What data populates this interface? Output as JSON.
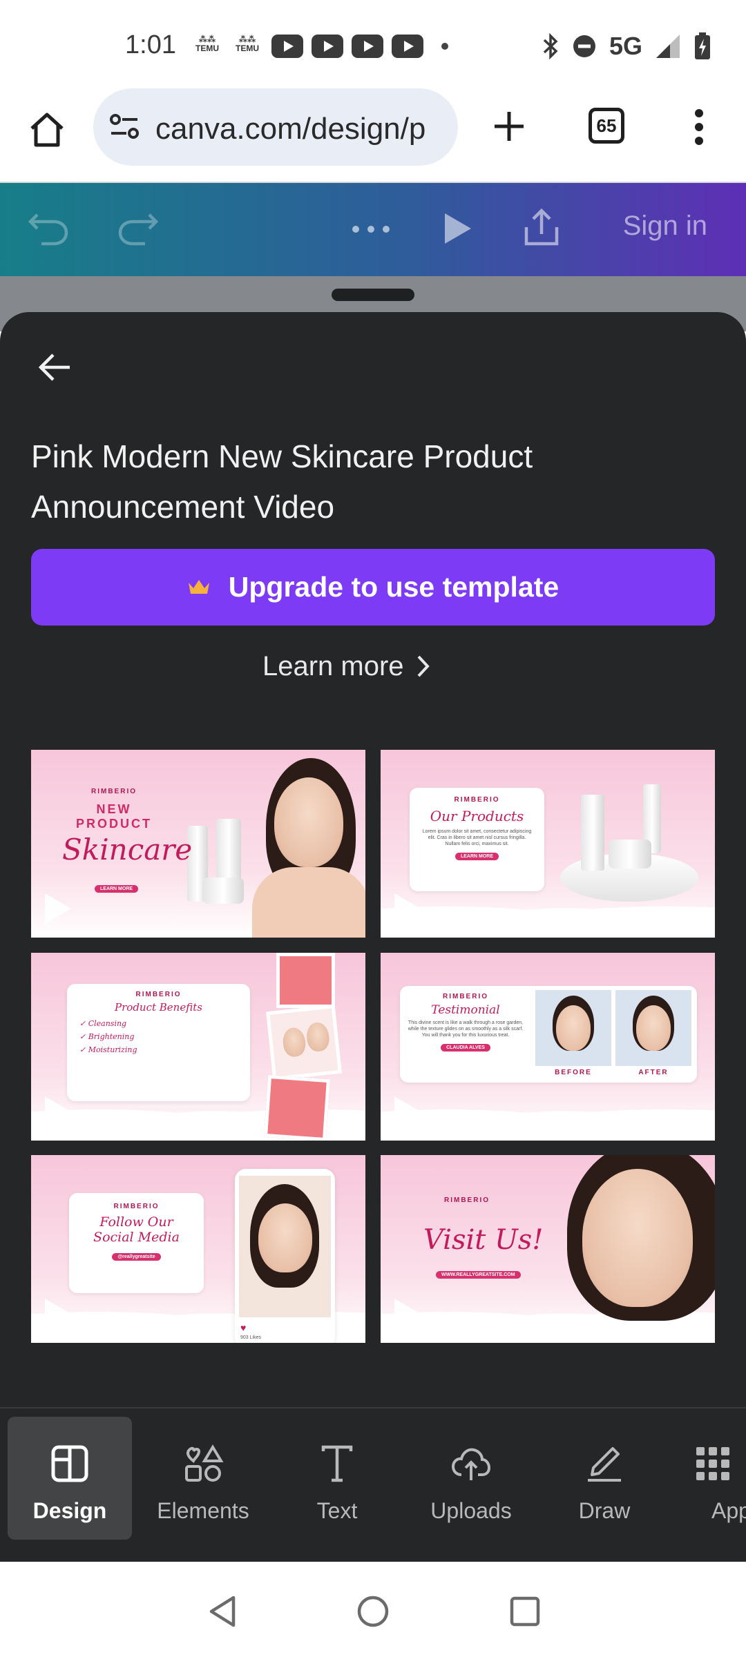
{
  "status_bar": {
    "time": "1:01",
    "temu_label": "TEMU",
    "network": "5G"
  },
  "browser": {
    "url": "canva.com/design/p",
    "tab_count": "65"
  },
  "canva_toolbar": {
    "signin_label": "Sign in"
  },
  "panel": {
    "title": "Pink Modern New Skincare Product Announcement Video",
    "upgrade_label": "Upgrade to use template",
    "learn_more_label": "Learn more"
  },
  "thumbnails": [
    {
      "brand": "RIMBERIO",
      "line1": "NEW",
      "line2": "PRODUCT",
      "script": "Skincare",
      "button": "LEARN MORE"
    },
    {
      "brand": "RIMBERIO",
      "script": "Our Products",
      "body": "Lorem ipsum dolor sit amet, consectetur adipiscing elit. Cras in libero sit amet nisl cursus fringilla. Nullam felis orci, maximus sit.",
      "button": "LEARN MORE"
    },
    {
      "brand": "RIMBERIO",
      "script": "Product Benefits",
      "items": [
        "Cleansing",
        "Brightening",
        "Moisturizing"
      ]
    },
    {
      "brand": "RIMBERIO",
      "script": "Testimonial",
      "body": "This divine scent is like a walk through a rose garden, while the texture glides on as smoothly as a silk scarf. You will thank you for this luxurious treat.",
      "name": "CLAUDIA ALVES",
      "before": "BEFORE",
      "after": "AFTER"
    },
    {
      "brand": "RIMBERIO",
      "script": "Follow Our Social Media",
      "handle": "@reallygreatsite",
      "likes": "903 Likes"
    },
    {
      "brand": "RIMBERIO",
      "script": "Visit Us!",
      "url": "WWW.REALLYGREATSITE.COM"
    }
  ],
  "bottom_nav": [
    {
      "label": "Design",
      "icon": "design-icon"
    },
    {
      "label": "Elements",
      "icon": "elements-icon"
    },
    {
      "label": "Text",
      "icon": "text-icon"
    },
    {
      "label": "Uploads",
      "icon": "uploads-icon"
    },
    {
      "label": "Draw",
      "icon": "draw-icon"
    },
    {
      "label": "Apps",
      "icon": "apps-icon"
    }
  ],
  "colors": {
    "canva_gradient_start": "#177e88",
    "canva_gradient_end": "#5e2fb5",
    "upgrade_button": "#7d3bf5",
    "panel_bg": "#252627"
  }
}
